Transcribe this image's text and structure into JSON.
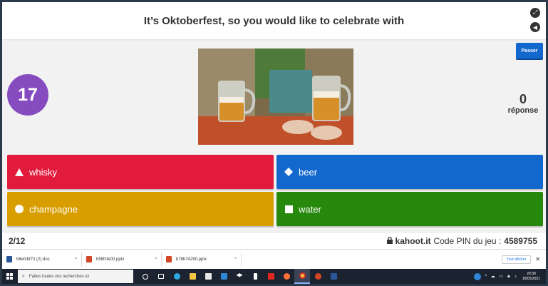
{
  "question": {
    "title": "It’s Oktoberfest, so you would like to celebrate with"
  },
  "timer": {
    "value": "17"
  },
  "skip_button": {
    "label": "Passer"
  },
  "answers_count": {
    "value": "0",
    "label": "réponse"
  },
  "image": {
    "alt": "oktoberfest-beer-image"
  },
  "choices": [
    {
      "label": "whisky",
      "shape": "triangle",
      "color": "#e21b3c"
    },
    {
      "label": "beer",
      "shape": "diamond",
      "color": "#1368ce"
    },
    {
      "label": "champagne",
      "shape": "circle",
      "color": "#d89e00"
    },
    {
      "label": "water",
      "shape": "square",
      "color": "#26890c"
    }
  ],
  "footer": {
    "progress": "2/12",
    "domain": "kahoot.it",
    "pin_label": "Code PIN du jeu :",
    "pin": "4589755"
  },
  "downloads": {
    "items": [
      {
        "name": "b6efcbf70 (2).doc",
        "icon": "word-doc-icon"
      },
      {
        "name": "b58fcfe00.pptx",
        "icon": "pptx-icon"
      },
      {
        "name": "b78b74290.pptx",
        "icon": "pptx-icon"
      }
    ],
    "show_all": "Tout afficher"
  },
  "taskbar": {
    "search_placeholder": "Faites toutes vos recherches ici",
    "time": "20:38",
    "date": "18/05/2021"
  }
}
